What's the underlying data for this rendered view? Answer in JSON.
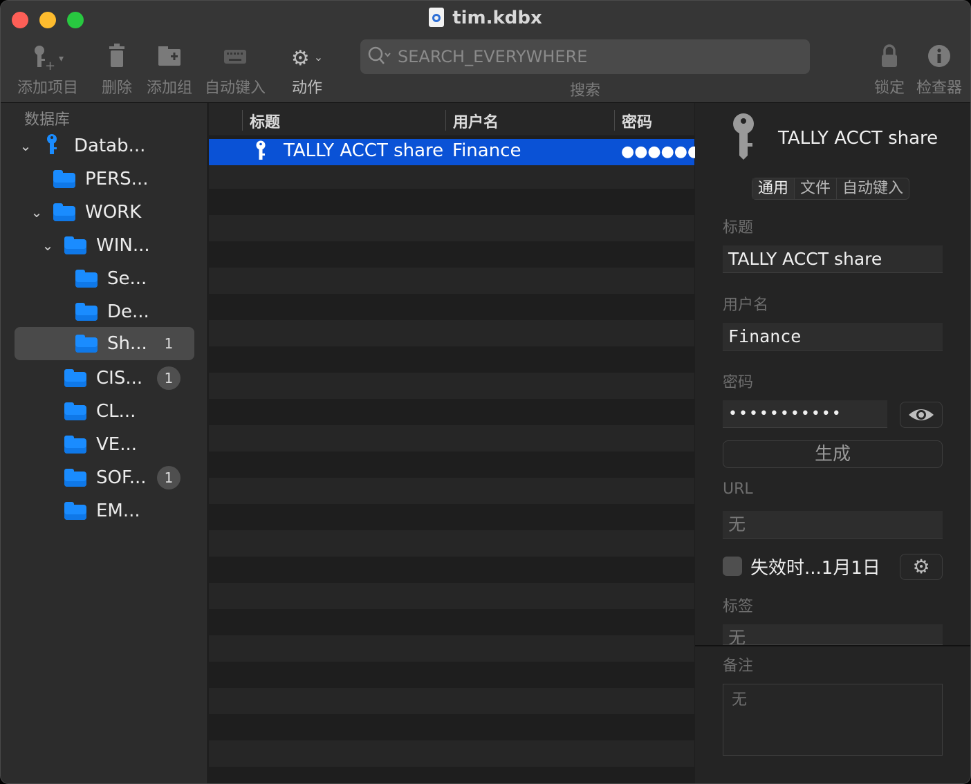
{
  "window": {
    "title": "tim.kdbx"
  },
  "toolbar": {
    "add_entry": "添加项目",
    "delete": "删除",
    "add_group": "添加组",
    "autotype": "自动键入",
    "action": "动作",
    "search_placeholder": "SEARCH_EVERYWHERE",
    "search_label": "搜索",
    "lock": "锁定",
    "inspector": "检查器"
  },
  "sidebar": {
    "header": "数据库",
    "database": "Datab...",
    "groups": [
      {
        "label": "PERS...",
        "badge": ""
      },
      {
        "label": "WORK",
        "badge": ""
      },
      {
        "label": "WIN...",
        "badge": ""
      },
      {
        "label": "Se...",
        "badge": ""
      },
      {
        "label": "De...",
        "badge": ""
      },
      {
        "label": "Sh...",
        "badge": "1"
      },
      {
        "label": "CIS...",
        "badge": "1"
      },
      {
        "label": "CL...",
        "badge": ""
      },
      {
        "label": "VE...",
        "badge": ""
      },
      {
        "label": "SOF...",
        "badge": "1"
      },
      {
        "label": "EM...",
        "badge": ""
      }
    ]
  },
  "list": {
    "columns": {
      "title": "标题",
      "username": "用户名",
      "password": "密码"
    },
    "rows": [
      {
        "title": "TALLY ACCT share",
        "username": "Finance",
        "password": "●●●●●●●"
      }
    ]
  },
  "inspector": {
    "entry_title": "TALLY ACCT share",
    "tabs": [
      "通用",
      "文件",
      "自动键入"
    ],
    "title_label": "标题",
    "title_value": "TALLY ACCT share",
    "username_label": "用户名",
    "username_value": "Finance",
    "password_label": "密码",
    "password_value": "•••••••••••",
    "generate": "生成",
    "url_label": "URL",
    "url_placeholder": "无",
    "expiry": "失效时...1月1日",
    "tags_label": "标签",
    "tags_placeholder": "无",
    "notes_label": "备注",
    "notes_placeholder": "无"
  },
  "colors": {
    "accent": "#1a8cff",
    "selection": "#0a52d6"
  }
}
